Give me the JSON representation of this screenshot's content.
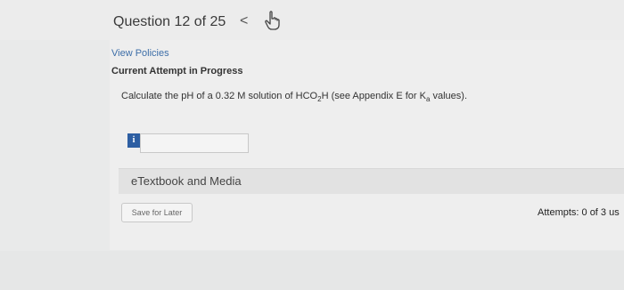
{
  "header": {
    "question_label": "Question 12 of 25",
    "prev_symbol": "<"
  },
  "policies": {
    "view_label": "View Policies",
    "attempt_status": "Current Attempt in Progress"
  },
  "question": {
    "text_before": "Calculate the pH of a 0.32 M solution of HCO",
    "sub_2": "2",
    "text_middle": "H (see Appendix E for K",
    "sub_a": "a",
    "text_after": " values)."
  },
  "answer": {
    "info_symbol": "i",
    "value": ""
  },
  "resources": {
    "etextbook_label": "eTextbook and Media"
  },
  "actions": {
    "save_label": "Save for Later",
    "attempts_text": "Attempts: 0 of 3 us"
  },
  "colors": {
    "link": "#3d6ea8",
    "info_badge": "#2d5ea2"
  }
}
